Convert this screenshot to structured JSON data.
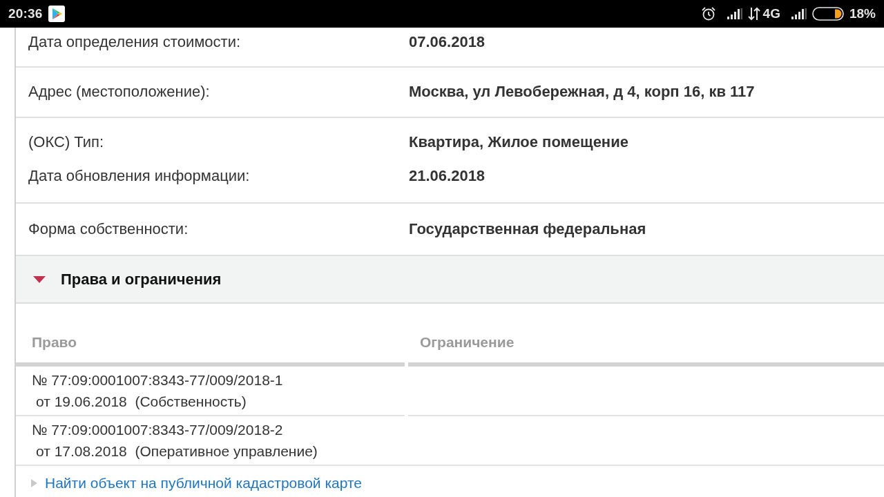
{
  "status_bar": {
    "time": "20:36",
    "network_type": "4G",
    "battery": "18%"
  },
  "details": [
    {
      "entries": [
        {
          "label": "Дата определения стоимости:",
          "value": "07.06.2018"
        }
      ]
    },
    {
      "entries": [
        {
          "label": "Адрес (местоположение):",
          "value": "Москва, ул Левобережная, д 4, корп 16, кв 117"
        }
      ]
    },
    {
      "entries": [
        {
          "label": "(ОКС) Тип:",
          "value": "Квартира, Жилое помещение"
        },
        {
          "label": "Дата обновления информации:",
          "value": "21.06.2018"
        }
      ]
    },
    {
      "entries": [
        {
          "label": "Форма собственности:",
          "value": "Государственная федеральная"
        }
      ]
    }
  ],
  "section": {
    "title": "Права и ограничения",
    "expanded": true
  },
  "rights_table": {
    "columns": [
      "Право",
      "Ограничение"
    ],
    "rows": [
      {
        "right": [
          "№ 77:09:0001007:8343-77/009/2018-1",
          "от 19.06.2018  (Собственность)"
        ]
      },
      {
        "right": [
          "№ 77:09:0001007:8343-77/009/2018-2",
          "от 17.08.2018  (Оперативное управление)"
        ]
      }
    ]
  },
  "map_link": {
    "label": "Найти объект на публичной кадастровой карте"
  }
}
